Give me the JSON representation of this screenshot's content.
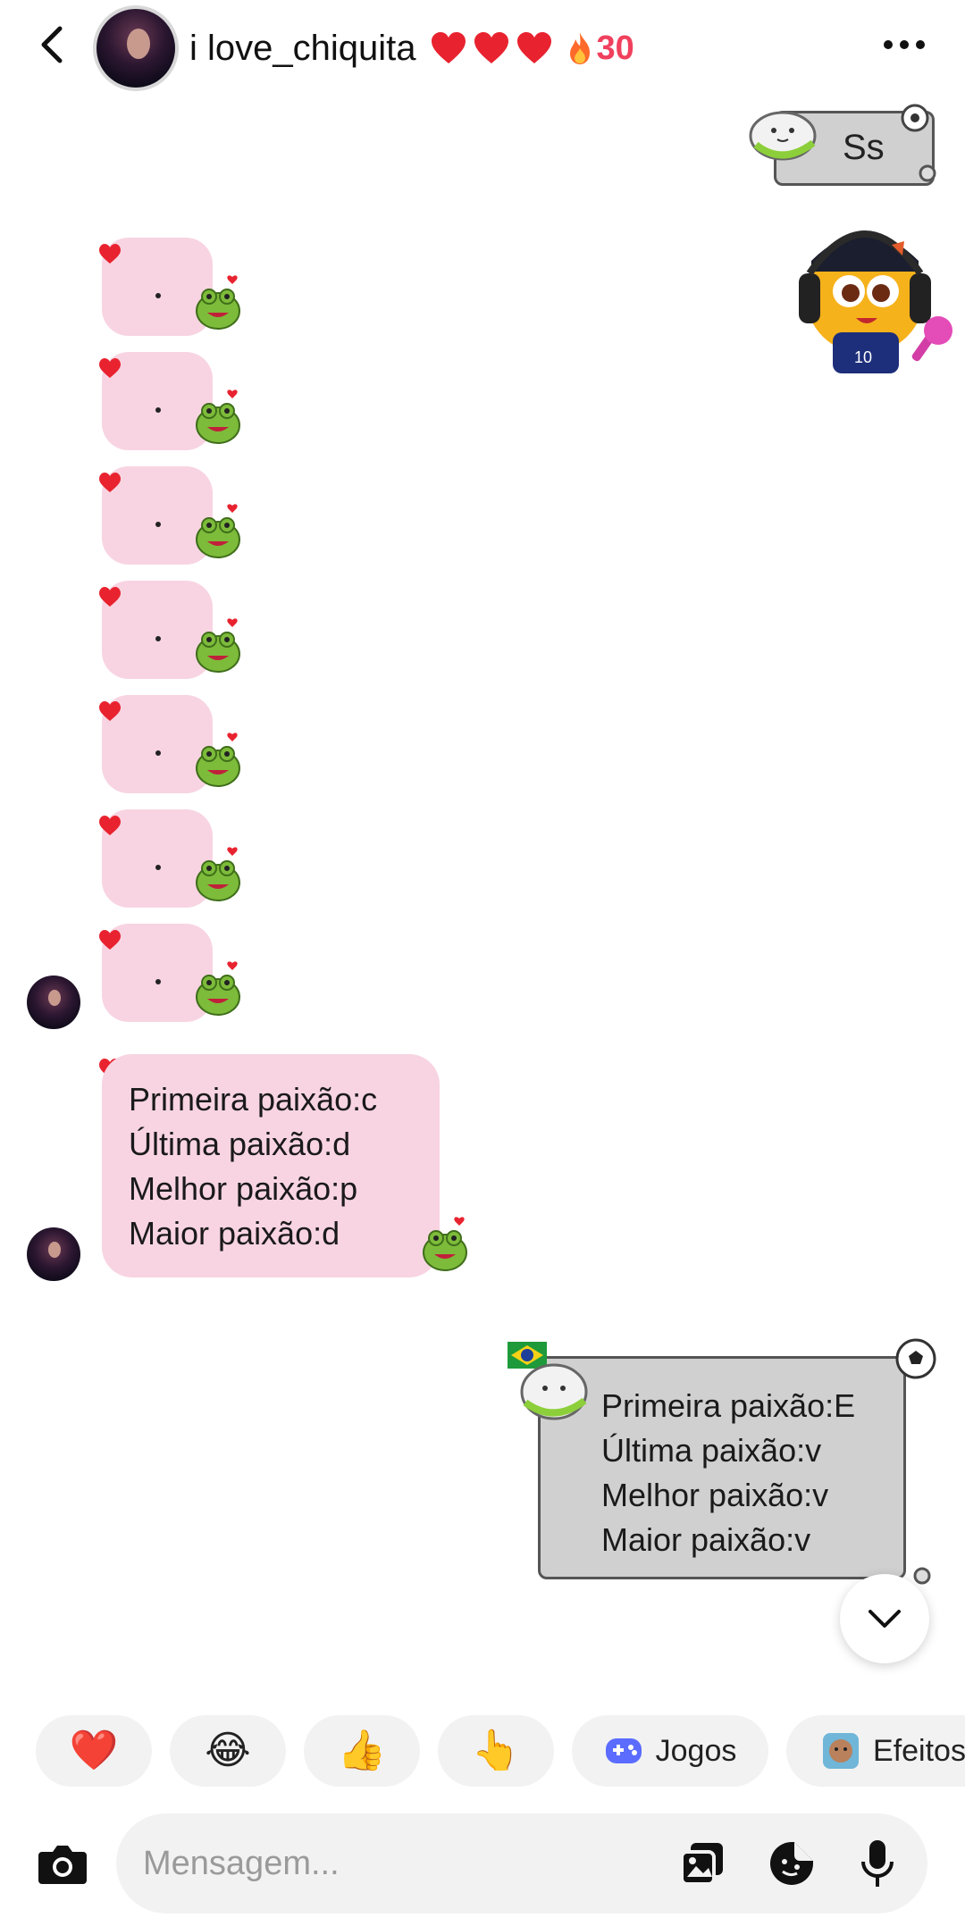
{
  "header": {
    "name": "i love_chiquita",
    "streak_count": "30",
    "heart_color": "#e8232f",
    "streak_color": "#f0405d"
  },
  "chat": {
    "sent_sticker_text": "Ss",
    "received_dot_messages": [
      ".",
      ".",
      ".",
      ".",
      ".",
      ".",
      "."
    ],
    "received_text": "Primeira paixão:c\nÚltima paixão:d\nMelhor paixão:p\nMaior paixão:d",
    "sent_text": "Primeira paixão:E\nÚltima paixão:v\nMelhor paixão:v\nMaior paixão:v",
    "bubble_colors": {
      "received": "#f8d4e2",
      "sent": "#d0d0d0"
    }
  },
  "quick_replies": [
    {
      "icon": "red-heart-icon",
      "emoji": "❤️"
    },
    {
      "icon": "laughing-face-icon",
      "emoji": "😂"
    },
    {
      "icon": "thumbs-up-icon",
      "emoji": "👍"
    },
    {
      "icon": "pointing-hand-icon",
      "emoji": "👆"
    },
    {
      "icon": "gamepad-icon",
      "label": "Jogos"
    },
    {
      "icon": "effects-icon",
      "label": "Efeitos"
    }
  ],
  "composer": {
    "placeholder": "Mensagem..."
  }
}
